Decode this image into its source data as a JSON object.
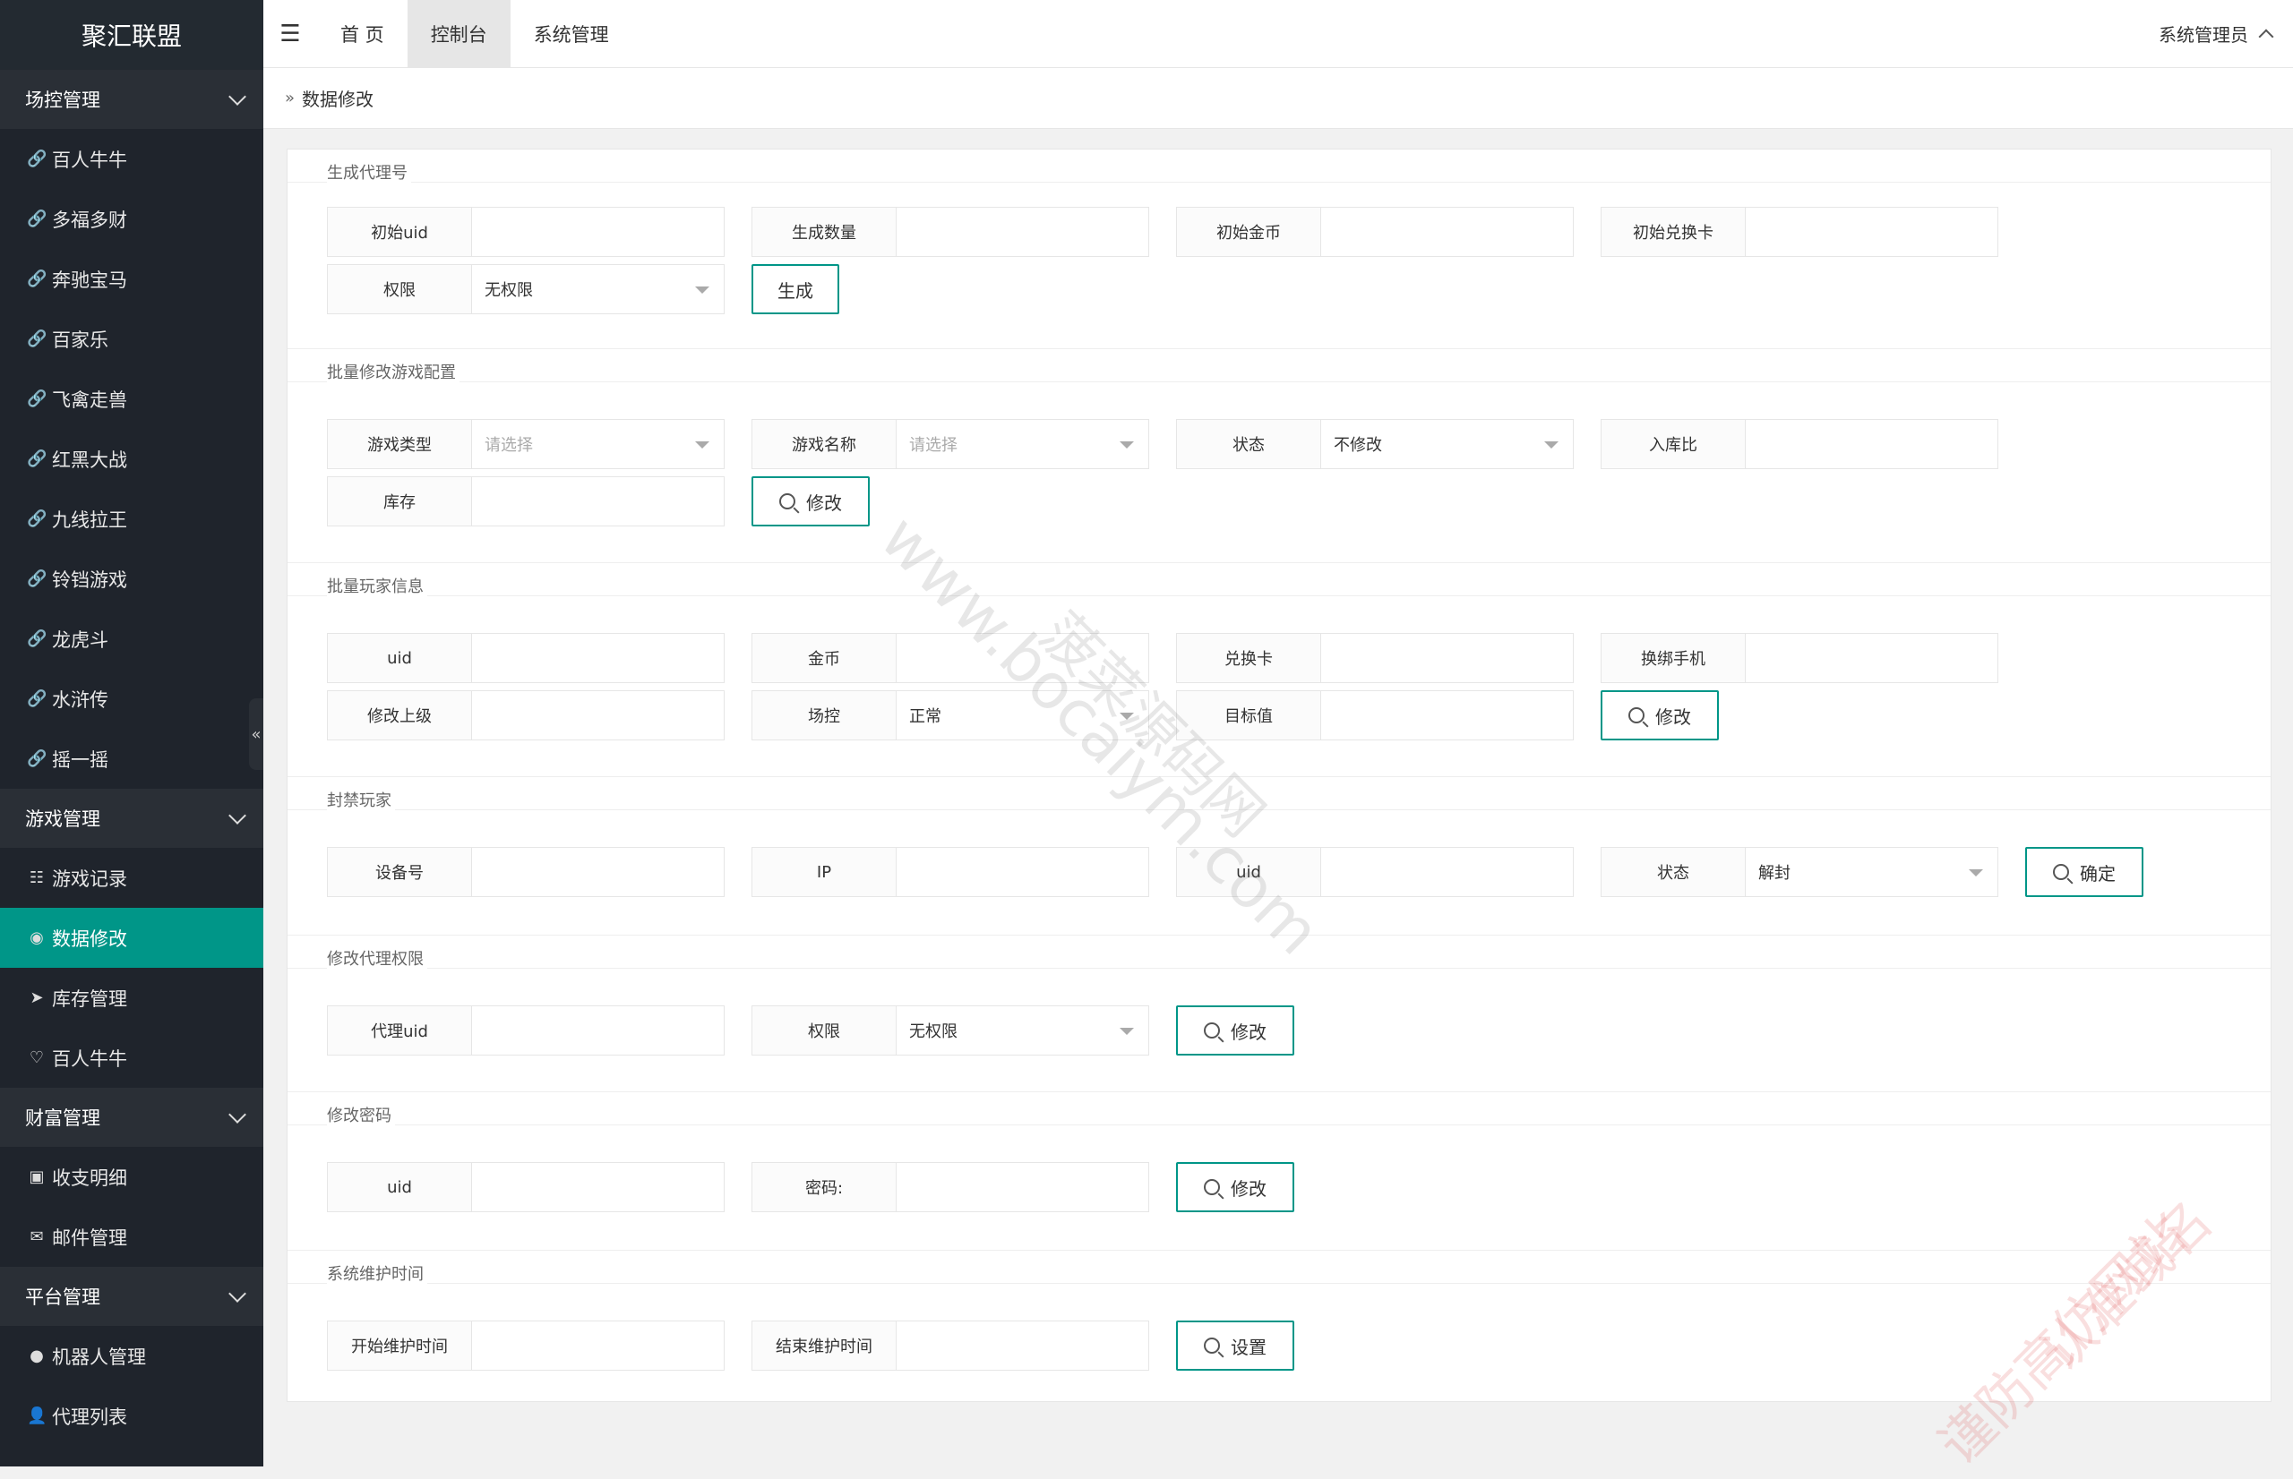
{
  "app": {
    "title": "聚汇联盟"
  },
  "sidebar": {
    "groups": [
      {
        "label": "场控管理",
        "items": [
          {
            "label": "百人牛牛",
            "icon": "link-icon"
          },
          {
            "label": "多福多财",
            "icon": "link-icon"
          },
          {
            "label": "奔驰宝马",
            "icon": "link-icon"
          },
          {
            "label": "百家乐",
            "icon": "link-icon"
          },
          {
            "label": "飞禽走兽",
            "icon": "link-icon"
          },
          {
            "label": "红黑大战",
            "icon": "link-icon"
          },
          {
            "label": "九线拉王",
            "icon": "link-icon"
          },
          {
            "label": "铃铛游戏",
            "icon": "link-icon"
          },
          {
            "label": "龙虎斗",
            "icon": "link-icon"
          },
          {
            "label": "水浒传",
            "icon": "link-icon"
          },
          {
            "label": "摇一摇",
            "icon": "link-icon"
          }
        ]
      },
      {
        "label": "游戏管理",
        "items": [
          {
            "label": "游戏记录",
            "icon": "list-icon"
          },
          {
            "label": "数据修改",
            "icon": "broadcast-icon",
            "active": true
          },
          {
            "label": "库存管理",
            "icon": "send-icon"
          },
          {
            "label": "百人牛牛",
            "icon": "heart-icon"
          }
        ]
      },
      {
        "label": "财富管理",
        "items": [
          {
            "label": "收支明细",
            "icon": "calendar-icon"
          },
          {
            "label": "邮件管理",
            "icon": "mail-icon"
          }
        ]
      },
      {
        "label": "平台管理",
        "items": [
          {
            "label": "机器人管理",
            "icon": "android-icon"
          },
          {
            "label": "代理列表",
            "icon": "user-icon"
          }
        ]
      }
    ]
  },
  "topbar": {
    "tabs": [
      {
        "label": "首 页"
      },
      {
        "label": "控制台",
        "active": true
      },
      {
        "label": "系统管理"
      }
    ],
    "user": "系统管理员"
  },
  "breadcrumb": {
    "current": "数据修改"
  },
  "sections": {
    "gen_agent": {
      "title": "生成代理号",
      "f1": "初始uid",
      "f2": "生成数量",
      "f3": "初始金币",
      "f4": "初始兑换卡",
      "perm_label": "权限",
      "perm_value": "无权限",
      "button": "生成"
    },
    "batch_game": {
      "title": "批量修改游戏配置",
      "type_label": "游戏类型",
      "type_placeholder": "请选择",
      "name_label": "游戏名称",
      "name_placeholder": "请选择",
      "status_label": "状态",
      "status_value": "不修改",
      "ratio_label": "入库比",
      "stock_label": "库存",
      "button": "修改"
    },
    "batch_player": {
      "title": "批量玩家信息",
      "uid_label": "uid",
      "gold_label": "金币",
      "card_label": "兑换卡",
      "phone_label": "换绑手机",
      "parent_label": "修改上级",
      "control_label": "场控",
      "control_value": "正常",
      "target_label": "目标值",
      "button": "修改"
    },
    "ban": {
      "title": "封禁玩家",
      "device_label": "设备号",
      "ip_label": "IP",
      "uid_label": "uid",
      "status_label": "状态",
      "status_value": "解封",
      "button": "确定"
    },
    "agent_perm": {
      "title": "修改代理权限",
      "uid_label": "代理uid",
      "perm_label": "权限",
      "perm_value": "无权限",
      "button": "修改"
    },
    "password": {
      "title": "修改密码",
      "uid_label": "uid",
      "pwd_label": "密码:",
      "button": "修改"
    },
    "maintenance": {
      "title": "系统维护时间",
      "start_label": "开始维护时间",
      "end_label": "结束维护时间",
      "button": "设置"
    }
  },
  "watermarks": {
    "center_text": "www.bocaiym.com",
    "center_text2": "菠菜源码网",
    "corner_text": "认准域名",
    "corner_text2": "谨防高仿网站"
  },
  "colors": {
    "sidebar_bg": "#1f242c",
    "accent": "#009688"
  }
}
